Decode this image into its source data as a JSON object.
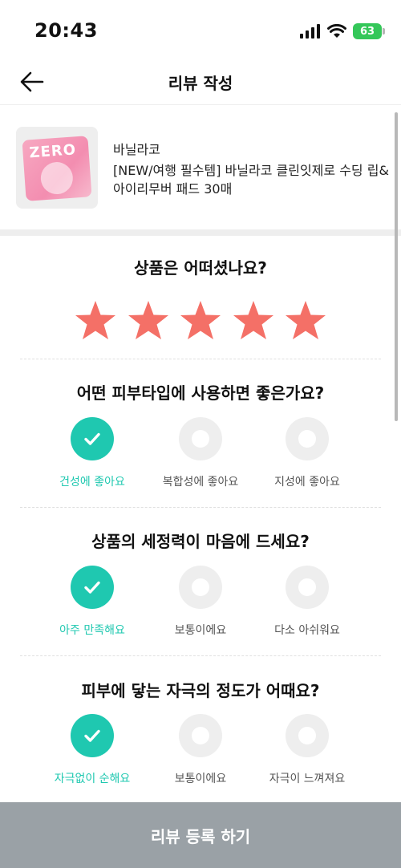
{
  "status": {
    "time": "20:43",
    "battery": "63"
  },
  "nav": {
    "title": "리뷰 작성"
  },
  "product": {
    "brand": "바닐라코",
    "name": "[NEW/여행 필수템] 바닐라코 클린잇제로 수딩 립&아이리무버 패드 30매",
    "package_text": "ZERO"
  },
  "rating": {
    "question": "상품은 어떠셨나요?",
    "stars": 5,
    "max": 5,
    "color": "#f47067"
  },
  "questions": [
    {
      "title": "어떤 피부타입에 사용하면 좋은가요?",
      "selected": 0,
      "options": [
        "건성에 좋아요",
        "복합성에 좋아요",
        "지성에 좋아요"
      ]
    },
    {
      "title": "상품의 세정력이 마음에 드세요?",
      "selected": 0,
      "options": [
        "아주 만족해요",
        "보통이에요",
        "다소 아쉬워요"
      ]
    },
    {
      "title": "피부에 닿는 자극의 정도가 어때요?",
      "selected": 0,
      "options": [
        "자극없이 순해요",
        "보통이에요",
        "자극이 느껴져요"
      ]
    }
  ],
  "submit": {
    "label": "리뷰 등록 하기"
  },
  "colors": {
    "accent": "#1fc8b0",
    "submit_bg": "#9aa1a6",
    "star": "#f47067"
  },
  "icons": {
    "back": "arrow-left-icon",
    "check": "check-icon",
    "star": "star-icon"
  }
}
